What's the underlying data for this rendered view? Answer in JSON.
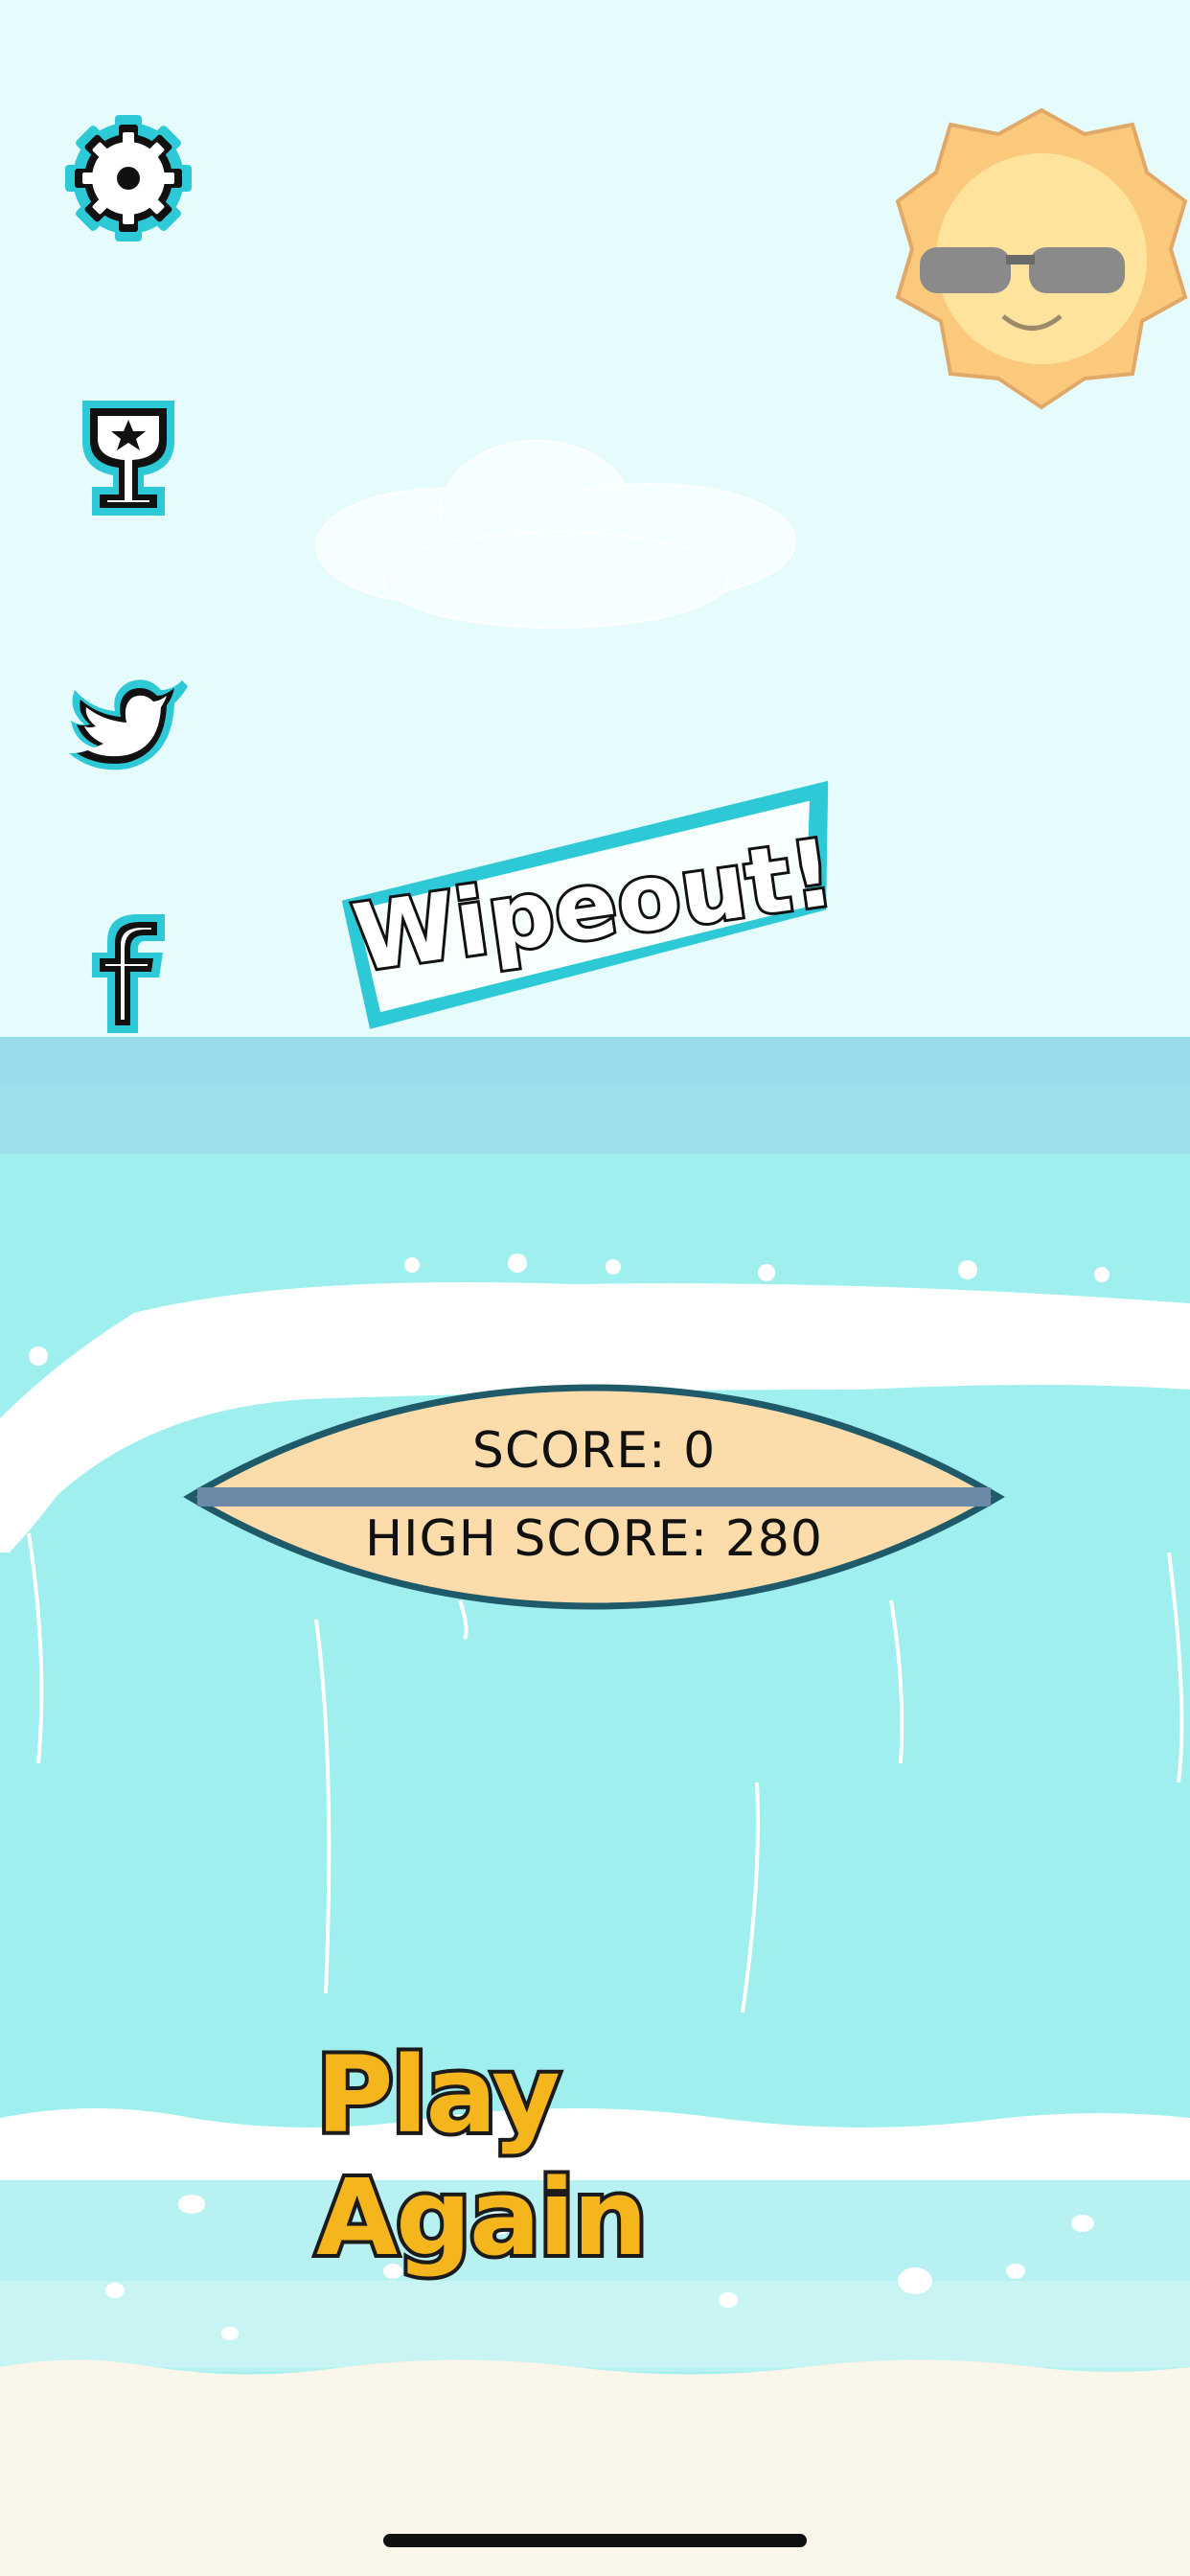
{
  "game": {
    "banner_text": "Wipeout!",
    "score_label": "SCORE: 0",
    "high_score_label": "HIGH SCORE: 280",
    "play_again_label": "Play Again"
  },
  "side_menu": [
    {
      "name": "settings",
      "icon": "gear-icon"
    },
    {
      "name": "leaderboard",
      "icon": "trophy-icon"
    },
    {
      "name": "twitter",
      "icon": "twitter-icon"
    },
    {
      "name": "facebook",
      "icon": "facebook-icon"
    }
  ],
  "colors": {
    "sky": "#e6fbfb",
    "ocean": "#9fefef",
    "accent_teal": "#2ec9d6",
    "play_again_yellow": "#f4b51d",
    "surfboard_fill": "#fbdcaa",
    "surfboard_stripe": "#6b8aa8",
    "surfboard_outline": "#1f5a6a",
    "sand": "#fbf6ea"
  }
}
